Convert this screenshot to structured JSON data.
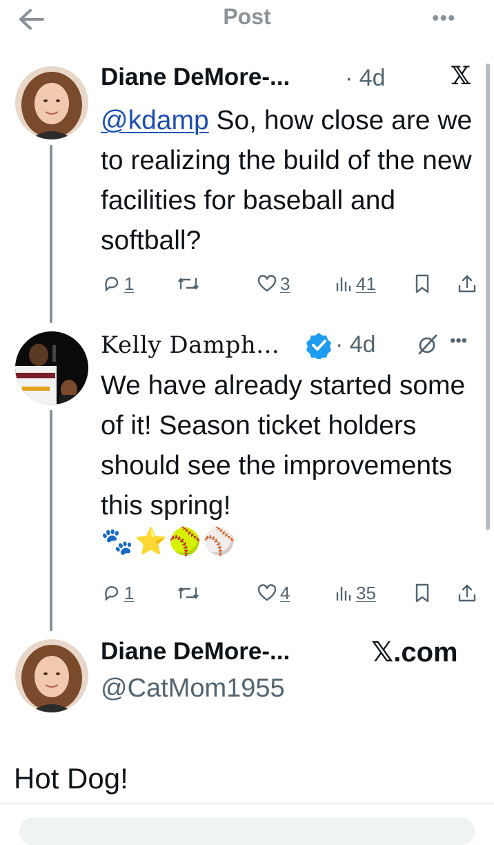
{
  "header": {
    "title": "Post",
    "back_icon": "arrow-left-icon",
    "more_icon": "more-horizontal-icon",
    "more_label": "•••"
  },
  "tweets": [
    {
      "author_name": "Diane DeMore-...",
      "time": "· 4d",
      "source_icon": "x-logo-icon",
      "source_label": "𝕏",
      "mention": "@kdamp",
      "text": " So, how close are we to realizing the build of the new facilities for baseball and softball?",
      "actions": {
        "replies": "1",
        "likes": "3",
        "views": "41"
      }
    },
    {
      "author_name": "Kelly Damph...",
      "time": "· 4d",
      "verified": true,
      "text": "We have already started some of it! Season ticket holders should see the improvements this spring!",
      "emoji": "🐾⭐🥎⚾",
      "actions": {
        "replies": "1",
        "likes": "4",
        "views": "35"
      }
    }
  ],
  "quoted": {
    "author_name": "Diane DeMore-...",
    "handle": "@CatMom1955",
    "source": "𝕏.com",
    "reply_text": "Hot Dog!"
  },
  "colors": {
    "accent_link": "#1d4fb0",
    "muted": "#536471",
    "verified_blue": "#1d9bf0"
  }
}
